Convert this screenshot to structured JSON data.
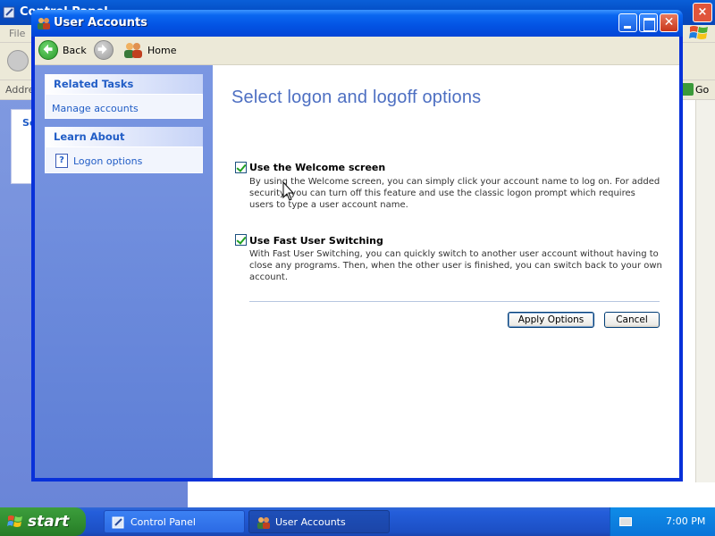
{
  "background_window": {
    "title": "Control Panel",
    "menu_file": "File",
    "address_label": "Address",
    "go_label": "Go",
    "panel_letter": "Se"
  },
  "window": {
    "title": "User Accounts"
  },
  "toolbar": {
    "back_label": "Back",
    "home_label": "Home"
  },
  "sidebar": {
    "related_tasks": {
      "header": "Related Tasks",
      "items": [
        {
          "label": "Manage accounts"
        }
      ]
    },
    "learn_about": {
      "header": "Learn About",
      "items": [
        {
          "label": "Logon options",
          "icon": "help-icon"
        }
      ]
    }
  },
  "content": {
    "title": "Select logon and logoff options",
    "options": [
      {
        "label": "Use the Welcome screen",
        "checked": true,
        "description": "By using the Welcome screen, you can simply click your account name to log on. For added security, you can turn off this feature and use the classic logon prompt which requires users to type a user account name."
      },
      {
        "label": "Use Fast User Switching",
        "checked": true,
        "description": "With Fast User Switching, you can quickly switch to another user account without having to close any programs. Then, when the other user is finished, you can switch back to your own account."
      }
    ],
    "apply_button": "Apply Options",
    "cancel_button": "Cancel"
  },
  "taskbar": {
    "start_label": "start",
    "items": [
      {
        "label": "Control Panel",
        "active": false
      },
      {
        "label": "User Accounts",
        "active": true
      }
    ],
    "clock": "7:00 PM"
  },
  "colors": {
    "title_blue": "#0353e3",
    "link_blue": "#215dc6",
    "heading_blue": "#4d6fc2",
    "sidebar_blue": "#7b97e2",
    "start_green": "#2f8b2f"
  }
}
